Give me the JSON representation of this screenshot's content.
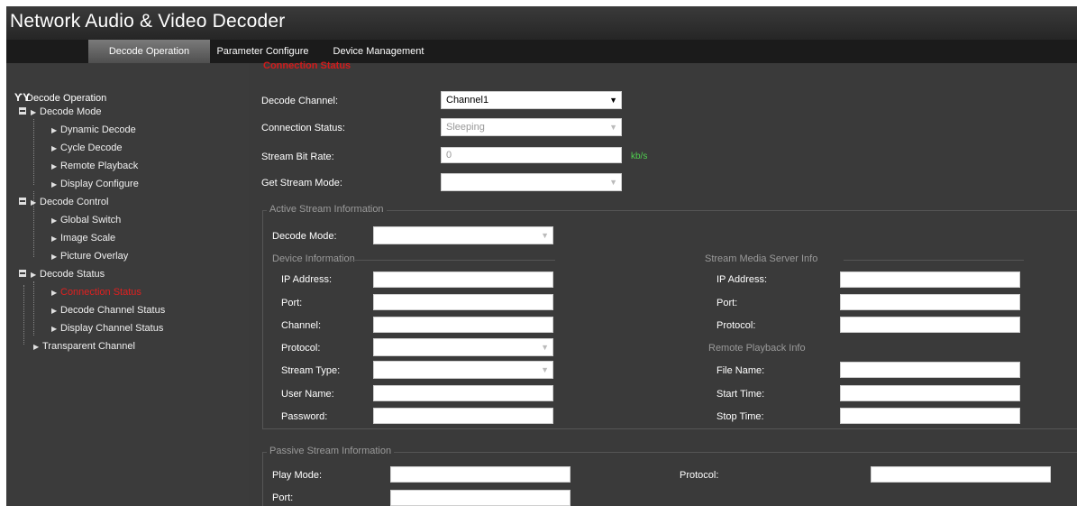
{
  "app": {
    "title": "Network Audio & Video Decoder"
  },
  "menu": {
    "tabs": [
      {
        "label": "Decode Operation",
        "active": true
      },
      {
        "label": "Parameter Configure",
        "active": false
      },
      {
        "label": "Device Management",
        "active": false
      }
    ]
  },
  "sidebar": {
    "root": "Decode Operation",
    "groups": [
      {
        "label": "Decode Mode",
        "items": [
          "Dynamic Decode",
          "Cycle Decode",
          "Remote Playback",
          "Display Configure"
        ]
      },
      {
        "label": "Decode Control",
        "items": [
          "Global Switch",
          "Image Scale",
          "Picture Overlay"
        ]
      },
      {
        "label": "Decode Status",
        "items": [
          "Connection Status",
          "Decode Channel Status",
          "Display Channel Status"
        ]
      }
    ],
    "extra": "Transparent Channel",
    "selected": "Connection Status"
  },
  "main": {
    "section_title": "Connection Status",
    "decode_channel": {
      "label": "Decode Channel:",
      "value": "Channel1"
    },
    "connection_status": {
      "label": "Connection Status:",
      "value": "Sleeping"
    },
    "stream_bit_rate": {
      "label": "Stream Bit Rate:",
      "value": "0",
      "unit": "kb/s"
    },
    "get_stream_mode": {
      "label": "Get Stream Mode:",
      "value": ""
    },
    "active_stream": {
      "title": "Active Stream Information",
      "decode_mode_label": "Decode Mode:",
      "device_info_title": "Device Information",
      "device_fields": [
        "IP Address:",
        "Port:",
        "Channel:",
        "Protocol:",
        "Stream Type:",
        "User Name:",
        "Password:"
      ],
      "server_info_title": "Stream Media Server Info",
      "server_fields": [
        "IP Address:",
        "Port:",
        "Protocol:"
      ],
      "playback_info_title": "Remote Playback Info",
      "playback_fields": [
        "File Name:",
        "Start Time:",
        "Stop Time:"
      ]
    },
    "passive_stream": {
      "title": "Passive Stream Information",
      "play_mode_label": "Play Mode:",
      "port_label": "Port:",
      "protocol_label": "Protocol:"
    }
  },
  "colors": {
    "accent_red": "#d21b1b",
    "unit_green": "#4fd04f",
    "panel": "#3a3a3a"
  }
}
